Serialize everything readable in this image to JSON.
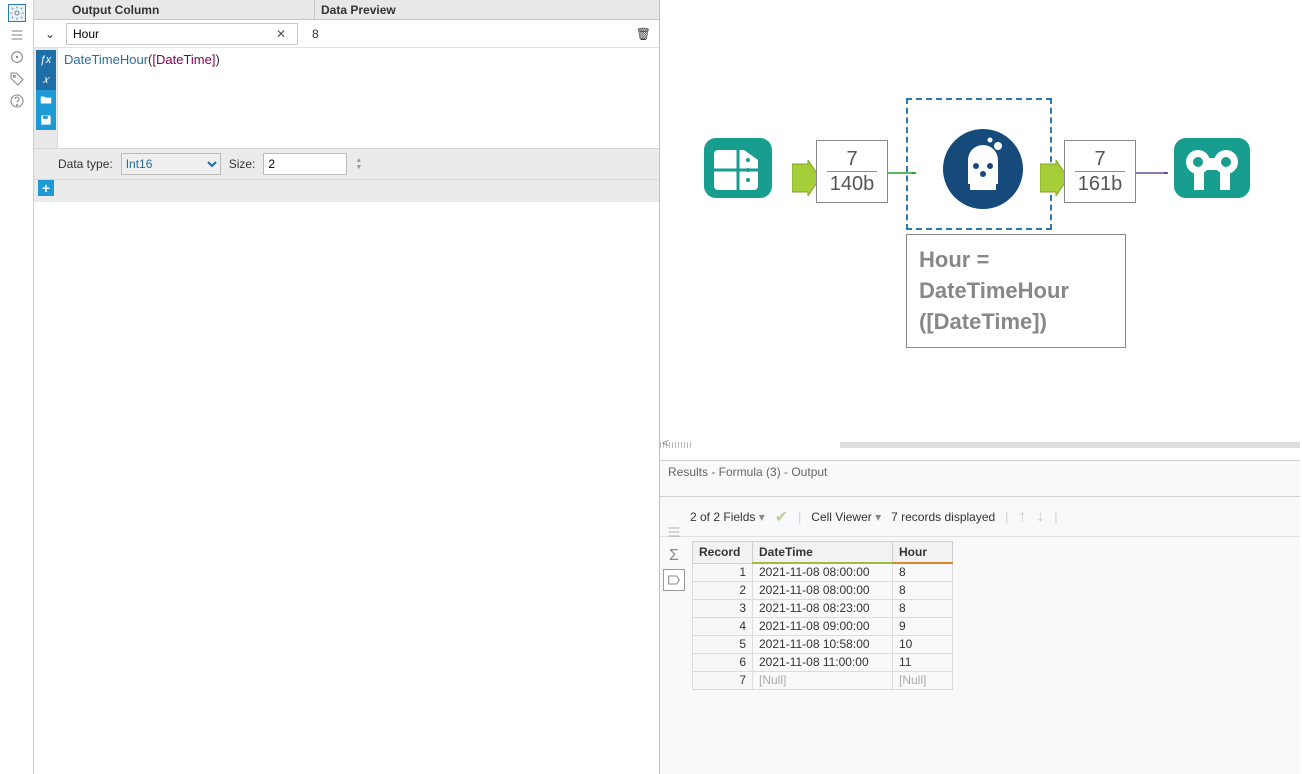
{
  "config": {
    "header": {
      "output_column": "Output Column",
      "data_preview": "Data Preview"
    },
    "output_name": "Hour",
    "preview_value": "8",
    "formula_display": {
      "fn": "DateTimeHour",
      "open": "(",
      "field": "[DateTime]",
      "close": ")"
    },
    "datatype_label": "Data type:",
    "datatype_value": "Int16",
    "size_label": "Size:",
    "size_value": "2"
  },
  "canvas": {
    "conn1": {
      "top": "7",
      "bottom": "140b"
    },
    "conn2": {
      "top": "7",
      "bottom": "161b"
    },
    "annotation_l1": "Hour =",
    "annotation_l2": "DateTimeHour",
    "annotation_l3": "([DateTime])"
  },
  "results": {
    "title": "Results - Formula (3) - Output",
    "fields_text": "2 of 2 Fields",
    "cell_viewer": "Cell Viewer",
    "records_text": "7 records displayed",
    "columns": {
      "record": "Record",
      "datetime": "DateTime",
      "hour": "Hour"
    },
    "rows": [
      {
        "n": "1",
        "dt": "2021-11-08 08:00:00",
        "hr": "8"
      },
      {
        "n": "2",
        "dt": "2021-11-08 08:00:00",
        "hr": "8"
      },
      {
        "n": "3",
        "dt": "2021-11-08 08:23:00",
        "hr": "8"
      },
      {
        "n": "4",
        "dt": "2021-11-08 09:00:00",
        "hr": "9"
      },
      {
        "n": "5",
        "dt": "2021-11-08 10:58:00",
        "hr": "10"
      },
      {
        "n": "6",
        "dt": "2021-11-08 11:00:00",
        "hr": "11"
      },
      {
        "n": "7",
        "dt": "[Null]",
        "hr": "[Null]"
      }
    ]
  }
}
